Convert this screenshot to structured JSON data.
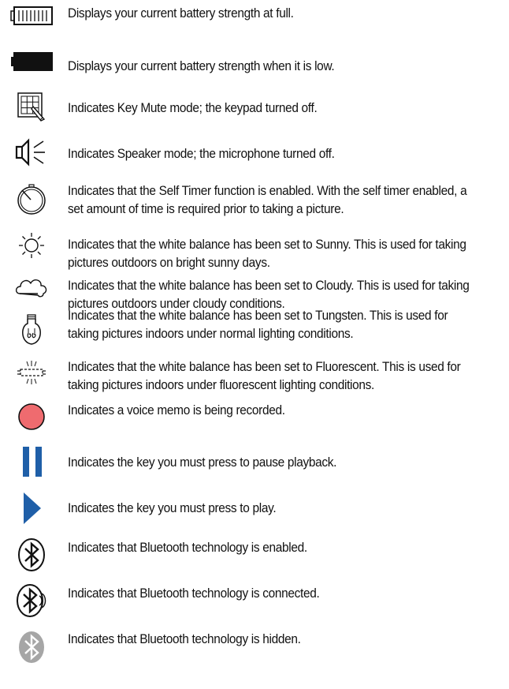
{
  "items": [
    {
      "icon": "battery-full-icon",
      "text": "Displays your current battery strength at full."
    },
    {
      "icon": "battery-low-icon",
      "text": "Displays your current battery strength when it is low."
    },
    {
      "icon": "key-mute-icon",
      "text": "Indicates Key Mute mode; the keypad turned off."
    },
    {
      "icon": "speaker-mode-icon",
      "text": "Indicates Speaker mode; the microphone turned off."
    },
    {
      "icon": "self-timer-icon",
      "text": "Indicates that the Self Timer function is enabled. With the self timer enabled, a set amount of time is required prior to taking a picture."
    },
    {
      "icon": "sunny-icon",
      "text": "Indicates that the white balance has been set to Sunny. This is used for taking pictures outdoors on bright sunny days."
    },
    {
      "icon": "cloudy-icon",
      "text": "Indicates that the white balance has been set to Cloudy. This is used for taking pictures outdoors under cloudy conditions."
    },
    {
      "icon": "tungsten-icon",
      "text": "Indicates that the white balance has been set to Tungsten. This is used for taking pictures indoors under normal lighting conditions."
    },
    {
      "icon": "fluorescent-icon",
      "text": "Indicates that the white balance has been set to Fluorescent. This is used for taking pictures indoors under fluorescent lighting conditions."
    },
    {
      "icon": "voice-memo-record-icon",
      "text": "Indicates a voice memo is being recorded."
    },
    {
      "icon": "pause-icon",
      "text": "Indicates the key you must press to pause playback."
    },
    {
      "icon": "play-icon",
      "text": "Indicates the key you must press to play."
    },
    {
      "icon": "bluetooth-enabled-icon",
      "text": "Indicates that Bluetooth technology is enabled."
    },
    {
      "icon": "bluetooth-connected-icon",
      "text": "Indicates that Bluetooth technology is connected."
    },
    {
      "icon": "bluetooth-hidden-icon",
      "text": "Indicates that Bluetooth technology is hidden."
    }
  ],
  "colors": {
    "text": "#111111",
    "record": "#ef6b6f",
    "media": "#1f5fa8",
    "bluetooth_hidden": "#a6a6a6"
  }
}
